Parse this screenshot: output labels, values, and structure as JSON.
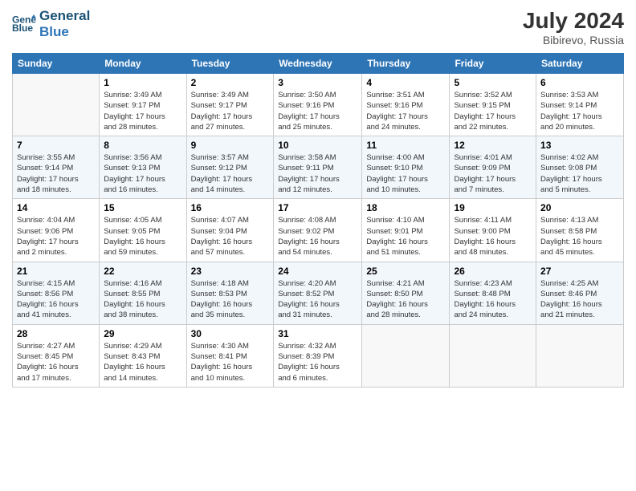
{
  "header": {
    "logo_line1": "General",
    "logo_line2": "Blue",
    "month_year": "July 2024",
    "location": "Bibirevo, Russia"
  },
  "days_of_week": [
    "Sunday",
    "Monday",
    "Tuesday",
    "Wednesday",
    "Thursday",
    "Friday",
    "Saturday"
  ],
  "weeks": [
    [
      {
        "num": "",
        "info": ""
      },
      {
        "num": "1",
        "info": "Sunrise: 3:49 AM\nSunset: 9:17 PM\nDaylight: 17 hours\nand 28 minutes."
      },
      {
        "num": "2",
        "info": "Sunrise: 3:49 AM\nSunset: 9:17 PM\nDaylight: 17 hours\nand 27 minutes."
      },
      {
        "num": "3",
        "info": "Sunrise: 3:50 AM\nSunset: 9:16 PM\nDaylight: 17 hours\nand 25 minutes."
      },
      {
        "num": "4",
        "info": "Sunrise: 3:51 AM\nSunset: 9:16 PM\nDaylight: 17 hours\nand 24 minutes."
      },
      {
        "num": "5",
        "info": "Sunrise: 3:52 AM\nSunset: 9:15 PM\nDaylight: 17 hours\nand 22 minutes."
      },
      {
        "num": "6",
        "info": "Sunrise: 3:53 AM\nSunset: 9:14 PM\nDaylight: 17 hours\nand 20 minutes."
      }
    ],
    [
      {
        "num": "7",
        "info": "Sunrise: 3:55 AM\nSunset: 9:14 PM\nDaylight: 17 hours\nand 18 minutes."
      },
      {
        "num": "8",
        "info": "Sunrise: 3:56 AM\nSunset: 9:13 PM\nDaylight: 17 hours\nand 16 minutes."
      },
      {
        "num": "9",
        "info": "Sunrise: 3:57 AM\nSunset: 9:12 PM\nDaylight: 17 hours\nand 14 minutes."
      },
      {
        "num": "10",
        "info": "Sunrise: 3:58 AM\nSunset: 9:11 PM\nDaylight: 17 hours\nand 12 minutes."
      },
      {
        "num": "11",
        "info": "Sunrise: 4:00 AM\nSunset: 9:10 PM\nDaylight: 17 hours\nand 10 minutes."
      },
      {
        "num": "12",
        "info": "Sunrise: 4:01 AM\nSunset: 9:09 PM\nDaylight: 17 hours\nand 7 minutes."
      },
      {
        "num": "13",
        "info": "Sunrise: 4:02 AM\nSunset: 9:08 PM\nDaylight: 17 hours\nand 5 minutes."
      }
    ],
    [
      {
        "num": "14",
        "info": "Sunrise: 4:04 AM\nSunset: 9:06 PM\nDaylight: 17 hours\nand 2 minutes."
      },
      {
        "num": "15",
        "info": "Sunrise: 4:05 AM\nSunset: 9:05 PM\nDaylight: 16 hours\nand 59 minutes."
      },
      {
        "num": "16",
        "info": "Sunrise: 4:07 AM\nSunset: 9:04 PM\nDaylight: 16 hours\nand 57 minutes."
      },
      {
        "num": "17",
        "info": "Sunrise: 4:08 AM\nSunset: 9:02 PM\nDaylight: 16 hours\nand 54 minutes."
      },
      {
        "num": "18",
        "info": "Sunrise: 4:10 AM\nSunset: 9:01 PM\nDaylight: 16 hours\nand 51 minutes."
      },
      {
        "num": "19",
        "info": "Sunrise: 4:11 AM\nSunset: 9:00 PM\nDaylight: 16 hours\nand 48 minutes."
      },
      {
        "num": "20",
        "info": "Sunrise: 4:13 AM\nSunset: 8:58 PM\nDaylight: 16 hours\nand 45 minutes."
      }
    ],
    [
      {
        "num": "21",
        "info": "Sunrise: 4:15 AM\nSunset: 8:56 PM\nDaylight: 16 hours\nand 41 minutes."
      },
      {
        "num": "22",
        "info": "Sunrise: 4:16 AM\nSunset: 8:55 PM\nDaylight: 16 hours\nand 38 minutes."
      },
      {
        "num": "23",
        "info": "Sunrise: 4:18 AM\nSunset: 8:53 PM\nDaylight: 16 hours\nand 35 minutes."
      },
      {
        "num": "24",
        "info": "Sunrise: 4:20 AM\nSunset: 8:52 PM\nDaylight: 16 hours\nand 31 minutes."
      },
      {
        "num": "25",
        "info": "Sunrise: 4:21 AM\nSunset: 8:50 PM\nDaylight: 16 hours\nand 28 minutes."
      },
      {
        "num": "26",
        "info": "Sunrise: 4:23 AM\nSunset: 8:48 PM\nDaylight: 16 hours\nand 24 minutes."
      },
      {
        "num": "27",
        "info": "Sunrise: 4:25 AM\nSunset: 8:46 PM\nDaylight: 16 hours\nand 21 minutes."
      }
    ],
    [
      {
        "num": "28",
        "info": "Sunrise: 4:27 AM\nSunset: 8:45 PM\nDaylight: 16 hours\nand 17 minutes."
      },
      {
        "num": "29",
        "info": "Sunrise: 4:29 AM\nSunset: 8:43 PM\nDaylight: 16 hours\nand 14 minutes."
      },
      {
        "num": "30",
        "info": "Sunrise: 4:30 AM\nSunset: 8:41 PM\nDaylight: 16 hours\nand 10 minutes."
      },
      {
        "num": "31",
        "info": "Sunrise: 4:32 AM\nSunset: 8:39 PM\nDaylight: 16 hours\nand 6 minutes."
      },
      {
        "num": "",
        "info": ""
      },
      {
        "num": "",
        "info": ""
      },
      {
        "num": "",
        "info": ""
      }
    ]
  ]
}
